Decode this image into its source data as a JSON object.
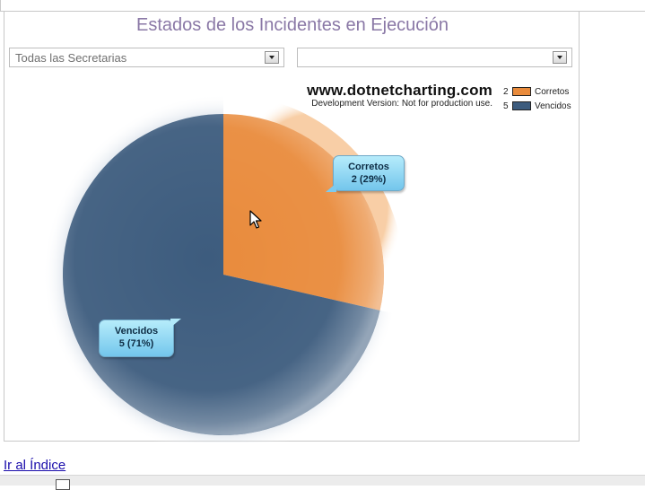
{
  "title": "Estados de los Incidentes en Ejecución",
  "filters": {
    "secretaria": {
      "value": "Todas las Secretarias"
    },
    "second": {
      "value": ""
    }
  },
  "watermark": {
    "site": "www.dotnetcharting.com",
    "notice": "Development Version: Not for production use."
  },
  "chart_data": {
    "type": "pie",
    "title": "Estados de los Incidentes en Ejecución",
    "slices": [
      {
        "name": "Corretos",
        "value": 2,
        "percent": 29,
        "color": "#e98b3c",
        "label_line1": "Corretos",
        "label_line2": "2 (29%)"
      },
      {
        "name": "Vencidos",
        "value": 5,
        "percent": 71,
        "color": "#3d5c7e",
        "label_line1": "Vencidos",
        "label_line2": "5 (71%)"
      }
    ],
    "legend": [
      {
        "count": "2",
        "name": "Corretos",
        "color": "#e98b3c"
      },
      {
        "count": "5",
        "name": "Vencidos",
        "color": "#3d5c7e"
      }
    ],
    "legend_position": "top-right"
  },
  "link": {
    "text": "Ir al Índice"
  },
  "icons": {
    "cursor": "mouse-pointer-icon",
    "dropdown": "chevron-down-icon"
  }
}
